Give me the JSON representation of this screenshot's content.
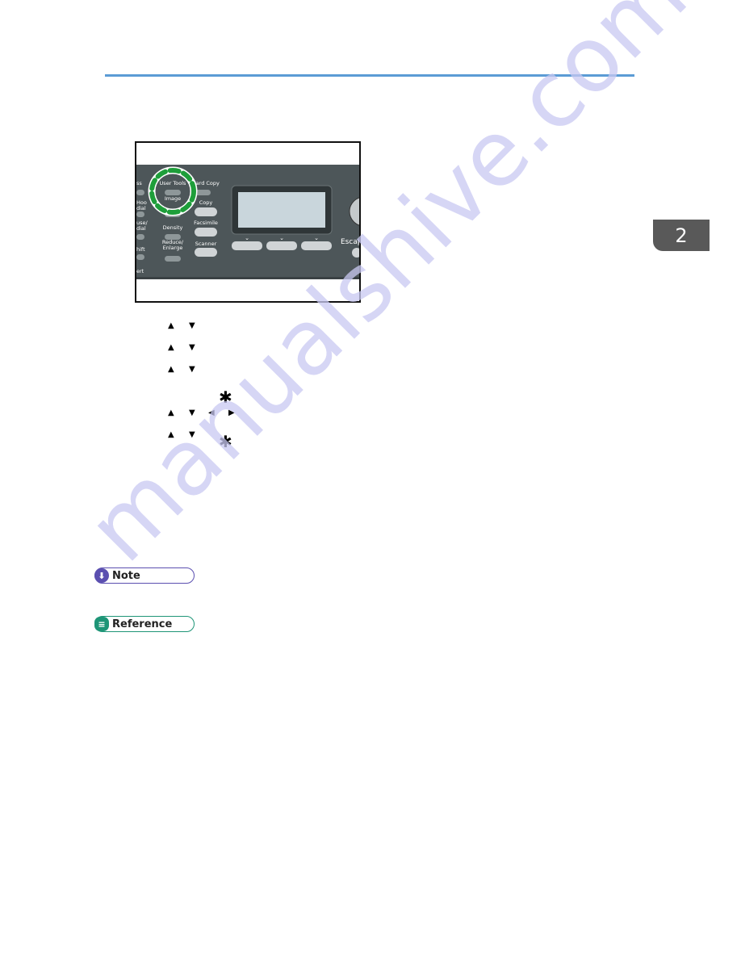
{
  "header": {
    "accent_color": "#5b9bd5"
  },
  "chapter_tab": {
    "number": "2",
    "color": "#595959"
  },
  "figure": {
    "panel_labels": [
      "User Tools",
      "Image",
      "Card Copy",
      "Copy",
      "Facsimile",
      "Scanner",
      "Density",
      "Reduce/",
      "Enlarge",
      "Escape",
      "ss",
      "Hoo",
      "dial",
      "use/",
      "dial",
      "hift",
      "ert"
    ],
    "highlight_color": "#1e9e3a"
  },
  "steps": {
    "arrow_rows": [
      [
        "▲",
        "▼"
      ],
      [
        "▲",
        "▼"
      ],
      [
        "▲",
        "▼"
      ],
      [
        "▲",
        "▼",
        "◀",
        "▶"
      ],
      [
        "▲",
        "▼"
      ]
    ],
    "asterisks": [
      "✱",
      "✱"
    ]
  },
  "note": {
    "label": "Note",
    "icon": "arrow-down-circle-icon",
    "color": "#5b4fb0"
  },
  "reference": {
    "label": "Reference",
    "icon": "document-icon",
    "color": "#1e9577"
  },
  "watermark": "manualshive.com"
}
